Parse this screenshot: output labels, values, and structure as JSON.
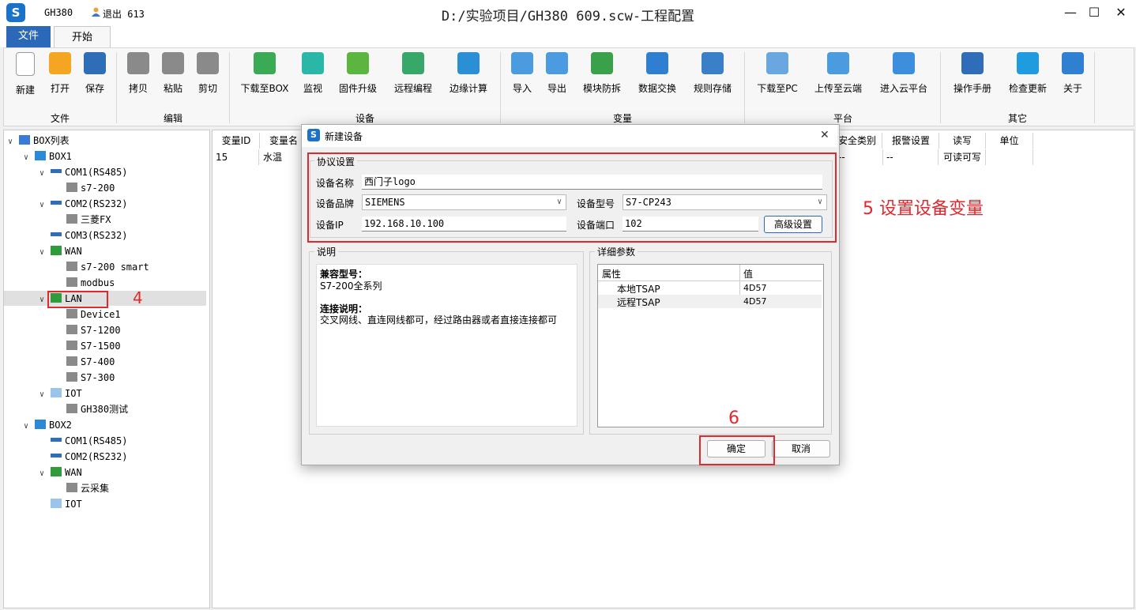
{
  "titlebar": {
    "app_name": "GH380",
    "logout": "退出 613",
    "title": "D:/实验项目/GH380 609.scw-工程配置",
    "minimize": "—",
    "maximize": "☐",
    "close": "✕"
  },
  "tabs": {
    "file": "文件",
    "start": "开始"
  },
  "ribbon": {
    "buttons": [
      {
        "label": "新建",
        "icon": "new-file-icon",
        "color": "#ffffff"
      },
      {
        "label": "打开",
        "icon": "open-folder-icon",
        "color": "#f4a623"
      },
      {
        "label": "保存",
        "icon": "save-icon",
        "color": "#2f6db8"
      },
      {
        "label": "拷贝",
        "icon": "copy-icon",
        "color": "#8a8a8a"
      },
      {
        "label": "粘贴",
        "icon": "paste-icon",
        "color": "#8a8a8a"
      },
      {
        "label": "剪切",
        "icon": "cut-icon",
        "color": "#8a8a8a"
      },
      {
        "label": "下载至BOX",
        "icon": "download-box-icon",
        "color": "#3aaa55"
      },
      {
        "label": "监视",
        "icon": "monitor-icon",
        "color": "#2bb7a8"
      },
      {
        "label": "固件升级",
        "icon": "firmware-upgrade-icon",
        "color": "#5bb53f"
      },
      {
        "label": "远程编程",
        "icon": "remote-program-icon",
        "color": "#37a86a"
      },
      {
        "label": "边缘计算",
        "icon": "edge-compute-icon",
        "color": "#2b8fd6"
      },
      {
        "label": "导入",
        "icon": "import-icon",
        "color": "#4b9be0"
      },
      {
        "label": "导出",
        "icon": "export-icon",
        "color": "#4b9be0"
      },
      {
        "label": "模块防拆",
        "icon": "lock-icon",
        "color": "#3aa14a"
      },
      {
        "label": "数据交换",
        "icon": "data-exchange-icon",
        "color": "#2f7fd0"
      },
      {
        "label": "规则存储",
        "icon": "rule-storage-icon",
        "color": "#3a80c9"
      },
      {
        "label": "下载至PC",
        "icon": "cloud-download-icon",
        "color": "#6aa7e0"
      },
      {
        "label": "上传至云端",
        "icon": "cloud-upload-icon",
        "color": "#4b9be0"
      },
      {
        "label": "进入云平台",
        "icon": "globe-icon",
        "color": "#3b8fdc"
      },
      {
        "label": "操作手册",
        "icon": "manual-icon",
        "color": "#2f6db8"
      },
      {
        "label": "检查更新",
        "icon": "update-icon",
        "color": "#1f9be0"
      },
      {
        "label": "关于",
        "icon": "info-icon",
        "color": "#2f80d0"
      }
    ],
    "groups": [
      "文件",
      "编辑",
      "设备",
      "变量",
      "平台",
      "其它"
    ]
  },
  "tree": [
    {
      "label": "BOX列表",
      "icon": "list-icon"
    },
    {
      "label": "BOX1",
      "icon": "box-icon"
    },
    {
      "label": "COM1(RS485)",
      "icon": "serial-port-icon"
    },
    {
      "label": "s7-200",
      "icon": "device-icon"
    },
    {
      "label": "COM2(RS232)",
      "icon": "serial-port-icon"
    },
    {
      "label": "三菱FX",
      "icon": "device-icon"
    },
    {
      "label": "COM3(RS232)",
      "icon": "serial-port-icon"
    },
    {
      "label": "WAN",
      "icon": "network-shield-icon"
    },
    {
      "label": "s7-200 smart",
      "icon": "device-icon"
    },
    {
      "label": "modbus",
      "icon": "device-icon"
    },
    {
      "label": "LAN",
      "icon": "network-shield-icon"
    },
    {
      "label": "Device1",
      "icon": "device-icon"
    },
    {
      "label": "S7-1200",
      "icon": "device-icon"
    },
    {
      "label": "S7-1500",
      "icon": "device-icon"
    },
    {
      "label": "S7-400",
      "icon": "device-icon"
    },
    {
      "label": "S7-300",
      "icon": "device-icon"
    },
    {
      "label": "IOT",
      "icon": "cloud-eye-icon"
    },
    {
      "label": "GH380测试",
      "icon": "device-icon"
    },
    {
      "label": "BOX2",
      "icon": "box-icon"
    },
    {
      "label": "COM1(RS485)",
      "icon": "serial-port-icon"
    },
    {
      "label": "COM2(RS232)",
      "icon": "serial-port-icon"
    },
    {
      "label": "WAN",
      "icon": "network-shield-icon"
    },
    {
      "label": "云采集",
      "icon": "device-icon"
    },
    {
      "label": "IOT",
      "icon": "cloud-eye-icon"
    }
  ],
  "annotations": {
    "step4": "4",
    "step5": "5 设置设备变量",
    "step6": "6"
  },
  "grid": {
    "headers": [
      "变量ID",
      "变量名",
      "安全类别",
      "报警设置",
      "读写",
      "单位"
    ],
    "row": [
      "15",
      "水温",
      "--",
      "--",
      "可读可写",
      ""
    ]
  },
  "dialog": {
    "title": "新建设备",
    "close": "✕",
    "protocol_legend": "协议设置",
    "name_label": "设备名称",
    "name_value": "西门子logo",
    "brand_label": "设备品牌",
    "brand_value": "SIEMENS",
    "model_label": "设备型号",
    "model_value": "S7-CP243",
    "ip_label": "设备IP",
    "ip_value": "192.168.10.100",
    "port_label": "设备端口",
    "port_value": "102",
    "advanced_button": "高级设置",
    "desc_legend": "说明",
    "desc_compat_title": "兼容型号：",
    "desc_compat_text": "S7-200全系列",
    "desc_conn_title": "连接说明：",
    "desc_conn_text": "交叉网线、直连网线都可，经过路由器或者直接连接都可",
    "params_legend": "详细参数",
    "params_headers": [
      "属性",
      "值"
    ],
    "params_rows": [
      [
        "本地TSAP",
        "4D57"
      ],
      [
        "远程TSAP",
        "4D57"
      ]
    ],
    "ok_button": "确定",
    "cancel_button": "取消"
  }
}
